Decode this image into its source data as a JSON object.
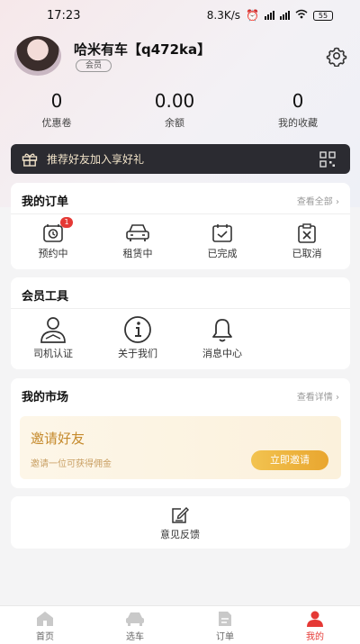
{
  "status_bar": {
    "time": "17:23",
    "network_speed": "8.3K/s",
    "battery": "55"
  },
  "profile": {
    "username": "哈米有车【q472ka】",
    "member_tag": "会员"
  },
  "stats": [
    {
      "value": "0",
      "label": "优惠卷"
    },
    {
      "value": "0.00",
      "label": "余额"
    },
    {
      "value": "0",
      "label": "我的收藏"
    }
  ],
  "banner": {
    "text": "推荐好友加入享好礼"
  },
  "orders": {
    "title": "我的订单",
    "more": "查看全部",
    "items": [
      {
        "label": "预约中",
        "icon": "alarm-clock-icon",
        "badge": "1"
      },
      {
        "label": "租赁中",
        "icon": "car-icon"
      },
      {
        "label": "已完成",
        "icon": "calendar-check-icon"
      },
      {
        "label": "已取消",
        "icon": "clipboard-x-icon"
      }
    ]
  },
  "tools": {
    "title": "会员工具",
    "items": [
      {
        "label": "司机认证",
        "icon": "driver-icon"
      },
      {
        "label": "关于我们",
        "icon": "info-icon"
      },
      {
        "label": "消息中心",
        "icon": "bell-icon"
      }
    ]
  },
  "market": {
    "title": "我的市场",
    "more": "查看详情",
    "invite_title": "邀请好友",
    "invite_sub": "邀请一位可获得佣金",
    "invite_button": "立即邀请"
  },
  "feedback": {
    "label": "意见反馈"
  },
  "tabbar": [
    {
      "label": "首页",
      "icon": "home-icon",
      "active": false
    },
    {
      "label": "选车",
      "icon": "car-icon",
      "active": false
    },
    {
      "label": "订单",
      "icon": "order-icon",
      "active": false
    },
    {
      "label": "我的",
      "icon": "user-icon",
      "active": true
    }
  ],
  "colors": {
    "accent": "#e53935",
    "gold": "#e9a62f",
    "banner_bg": "#2b2b31"
  }
}
